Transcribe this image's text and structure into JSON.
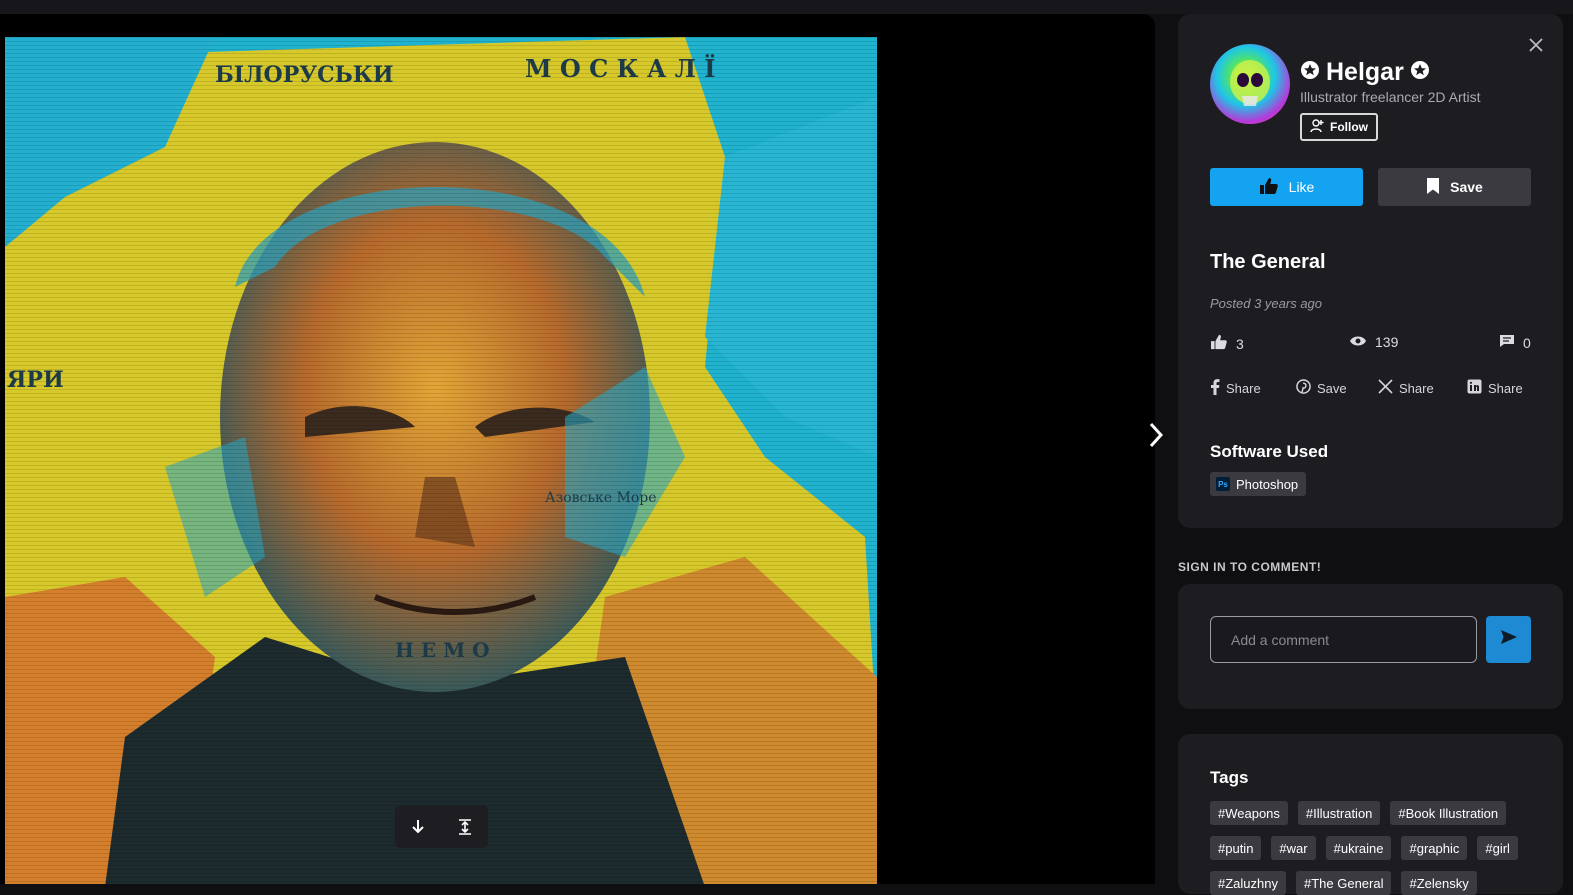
{
  "artist": {
    "name": "Helgar",
    "subtitle": "Illustrator freelancer 2D Artist",
    "follow_label": "Follow"
  },
  "actions": {
    "like_label": "Like",
    "save_label": "Save"
  },
  "artwork": {
    "title": "The General",
    "posted": "Posted 3 years ago",
    "map_labels": [
      "БІЛОРУСЬКИ",
      "М О С К А Л Ї",
      "ЯРИ",
      "Азовське Море",
      "Н Е М О"
    ]
  },
  "stats": {
    "likes": "3",
    "views": "139",
    "comments": "0"
  },
  "share": {
    "facebook": "Share",
    "pinterest": "Save",
    "x": "Share",
    "linkedin": "Share"
  },
  "software": {
    "heading": "Software Used",
    "items": [
      {
        "name": "Photoshop",
        "badge": "Ps"
      }
    ]
  },
  "comments": {
    "signin_label": "SIGN IN TO COMMENT!",
    "placeholder": "Add a comment"
  },
  "tags": {
    "heading": "Tags",
    "items": [
      "#Weapons",
      "#Illustration",
      "#Book Illustration",
      "#putin",
      "#war",
      "#ukraine",
      "#graphic",
      "#girl",
      "#Zaluzhny",
      "#The General",
      "#Zelensky"
    ]
  },
  "colors": {
    "accent": "#14a3f1",
    "panel": "#1d1d21",
    "chip": "#3a3a40",
    "send": "#1f8ad4"
  }
}
